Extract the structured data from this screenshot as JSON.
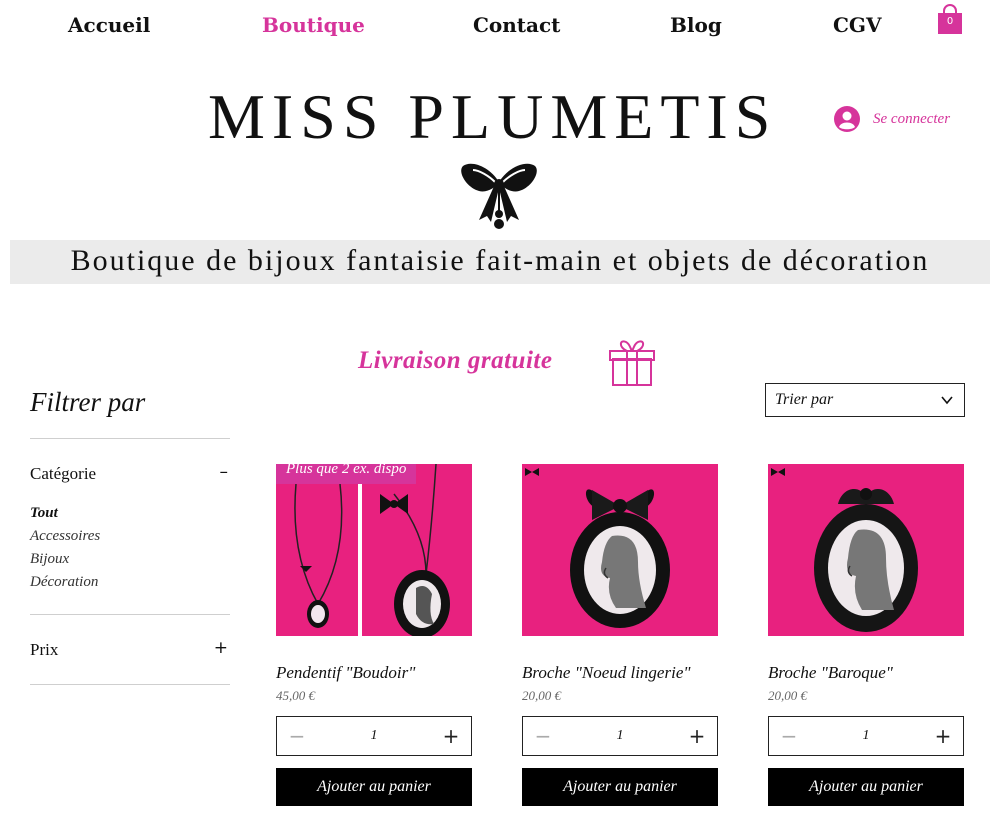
{
  "colors": {
    "accent": "#d6349b",
    "product_bg": "#e8217f",
    "button": "#000000",
    "band": "#ebebeb"
  },
  "nav": {
    "items": [
      {
        "label": "Accueil",
        "active": false
      },
      {
        "label": "Boutique",
        "active": true
      },
      {
        "label": "Contact",
        "active": false
      },
      {
        "label": "Blog",
        "active": false
      },
      {
        "label": "CGV",
        "active": false
      }
    ],
    "cart": {
      "icon": "shopping-bag-icon",
      "count": "0"
    }
  },
  "header": {
    "logo": "MISS PLUMETIS",
    "logo_icon": "bow-icon",
    "login": {
      "icon": "user-avatar-icon",
      "label": "Se connecter"
    },
    "tagline": "Boutique de bijoux fantaisie fait-main et objets de décoration",
    "shipping": {
      "label": "Livraison gratuite",
      "icon": "gift-icon"
    }
  },
  "filters": {
    "title": "Filtrer par",
    "category": {
      "label": "Catégorie",
      "toggle": "–",
      "items": [
        {
          "label": "Tout",
          "selected": true
        },
        {
          "label": "Accessoires",
          "selected": false
        },
        {
          "label": "Bijoux",
          "selected": false
        },
        {
          "label": "Décoration",
          "selected": false
        }
      ]
    },
    "price": {
      "label": "Prix",
      "toggle": "+"
    }
  },
  "sort": {
    "label": "Trier par",
    "icon": "chevron-down-icon"
  },
  "products": [
    {
      "name": "Pendentif \"Boudoir\"",
      "price": "45,00 €",
      "ribbon": "Plus que 2 ex. dispo",
      "qty": "1",
      "add_label": "Ajouter au panier",
      "image": "pendant-necklace-photo"
    },
    {
      "name": "Broche \"Noeud lingerie\"",
      "price": "20,00 €",
      "ribbon": "",
      "qty": "1",
      "add_label": "Ajouter au panier",
      "image": "bow-brooch-photo"
    },
    {
      "name": "Broche \"Baroque\"",
      "price": "20,00 €",
      "ribbon": "",
      "qty": "1",
      "add_label": "Ajouter au panier",
      "image": "baroque-brooch-photo"
    }
  ],
  "qty_controls": {
    "minus": "−",
    "plus": "+"
  }
}
